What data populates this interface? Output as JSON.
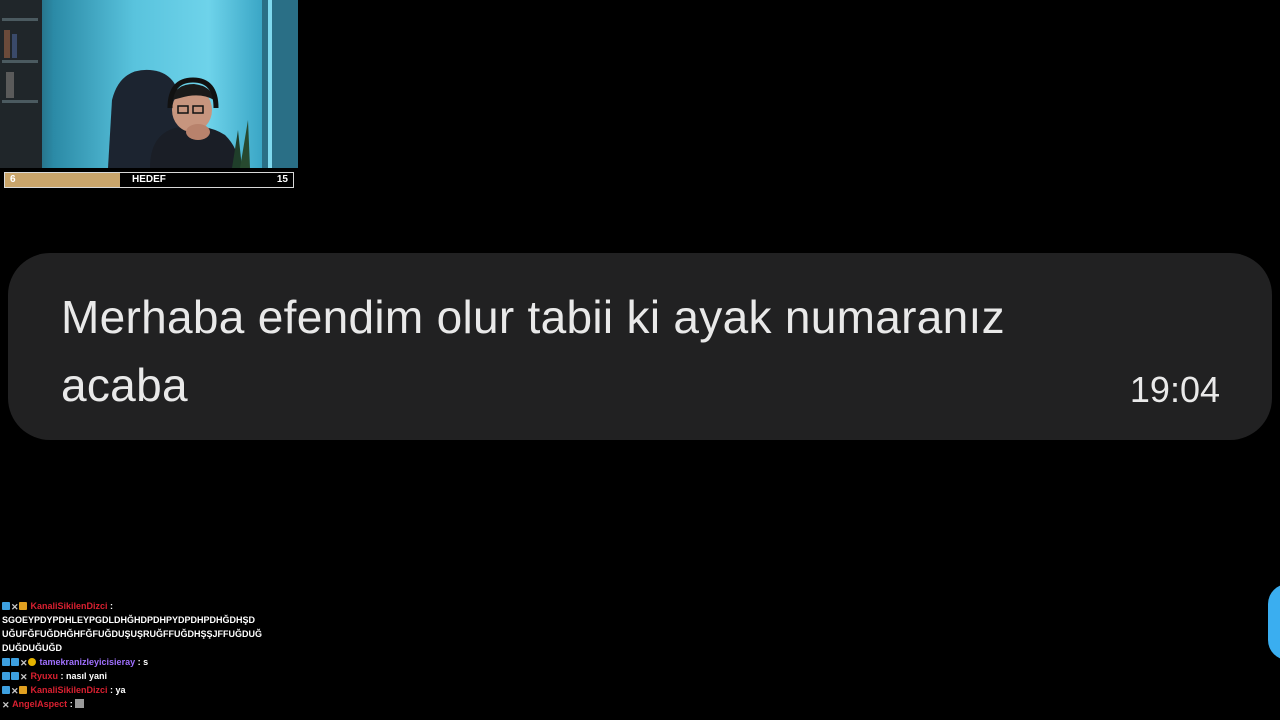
{
  "goal": {
    "current": "6",
    "label": "HEDEF",
    "target": "15",
    "progress_fraction": 0.4
  },
  "message": {
    "text": "Merhaba efendim olur tabii ki ayak numaranız acaba",
    "time": "19:04"
  },
  "chat": {
    "messages": [
      {
        "badges": [
          "blue-badge-icon",
          "x-badge-icon",
          "crown-badge-icon"
        ],
        "user": "KanaliSikilenDizci",
        "user_color": "#d92030",
        "separator": " :",
        "text": "SGOEYPDYPDHLEYPGDLDHĞHDPDHPYDPDHPDHĞDHŞD UĞUFĞFUĞDHĞHFĞFUĞDUŞUŞRUĞFFUĞDHŞŞJFFUĞDUĞ DUĞDUĞUĞD"
      },
      {
        "badges": [
          "sub-badge-icon",
          "blue-badge-icon",
          "x-badge-icon",
          "coin-badge-icon"
        ],
        "user": "tamekranizleyicisieray",
        "user_color": "#a070ff",
        "separator": " : ",
        "text": "s"
      },
      {
        "badges": [
          "sub-badge-icon",
          "blue-badge-icon",
          "x-badge-icon"
        ],
        "user": "Ryuxu",
        "user_color": "#d92030",
        "separator": " : ",
        "text": "nasıl yani"
      },
      {
        "badges": [
          "blue-badge-icon",
          "x-badge-icon",
          "crown-badge-icon"
        ],
        "user": "KanaliSikilenDizci",
        "user_color": "#d92030",
        "separator": " : ",
        "text": "ya"
      },
      {
        "badges": [
          "x-badge-icon"
        ],
        "user": "AngelAspect",
        "user_color": "#d92030",
        "separator": " : ",
        "text": ""
      }
    ]
  },
  "colors": {
    "bubble": "#212122",
    "goal_fill": "#c9a56b",
    "background": "#000000"
  }
}
